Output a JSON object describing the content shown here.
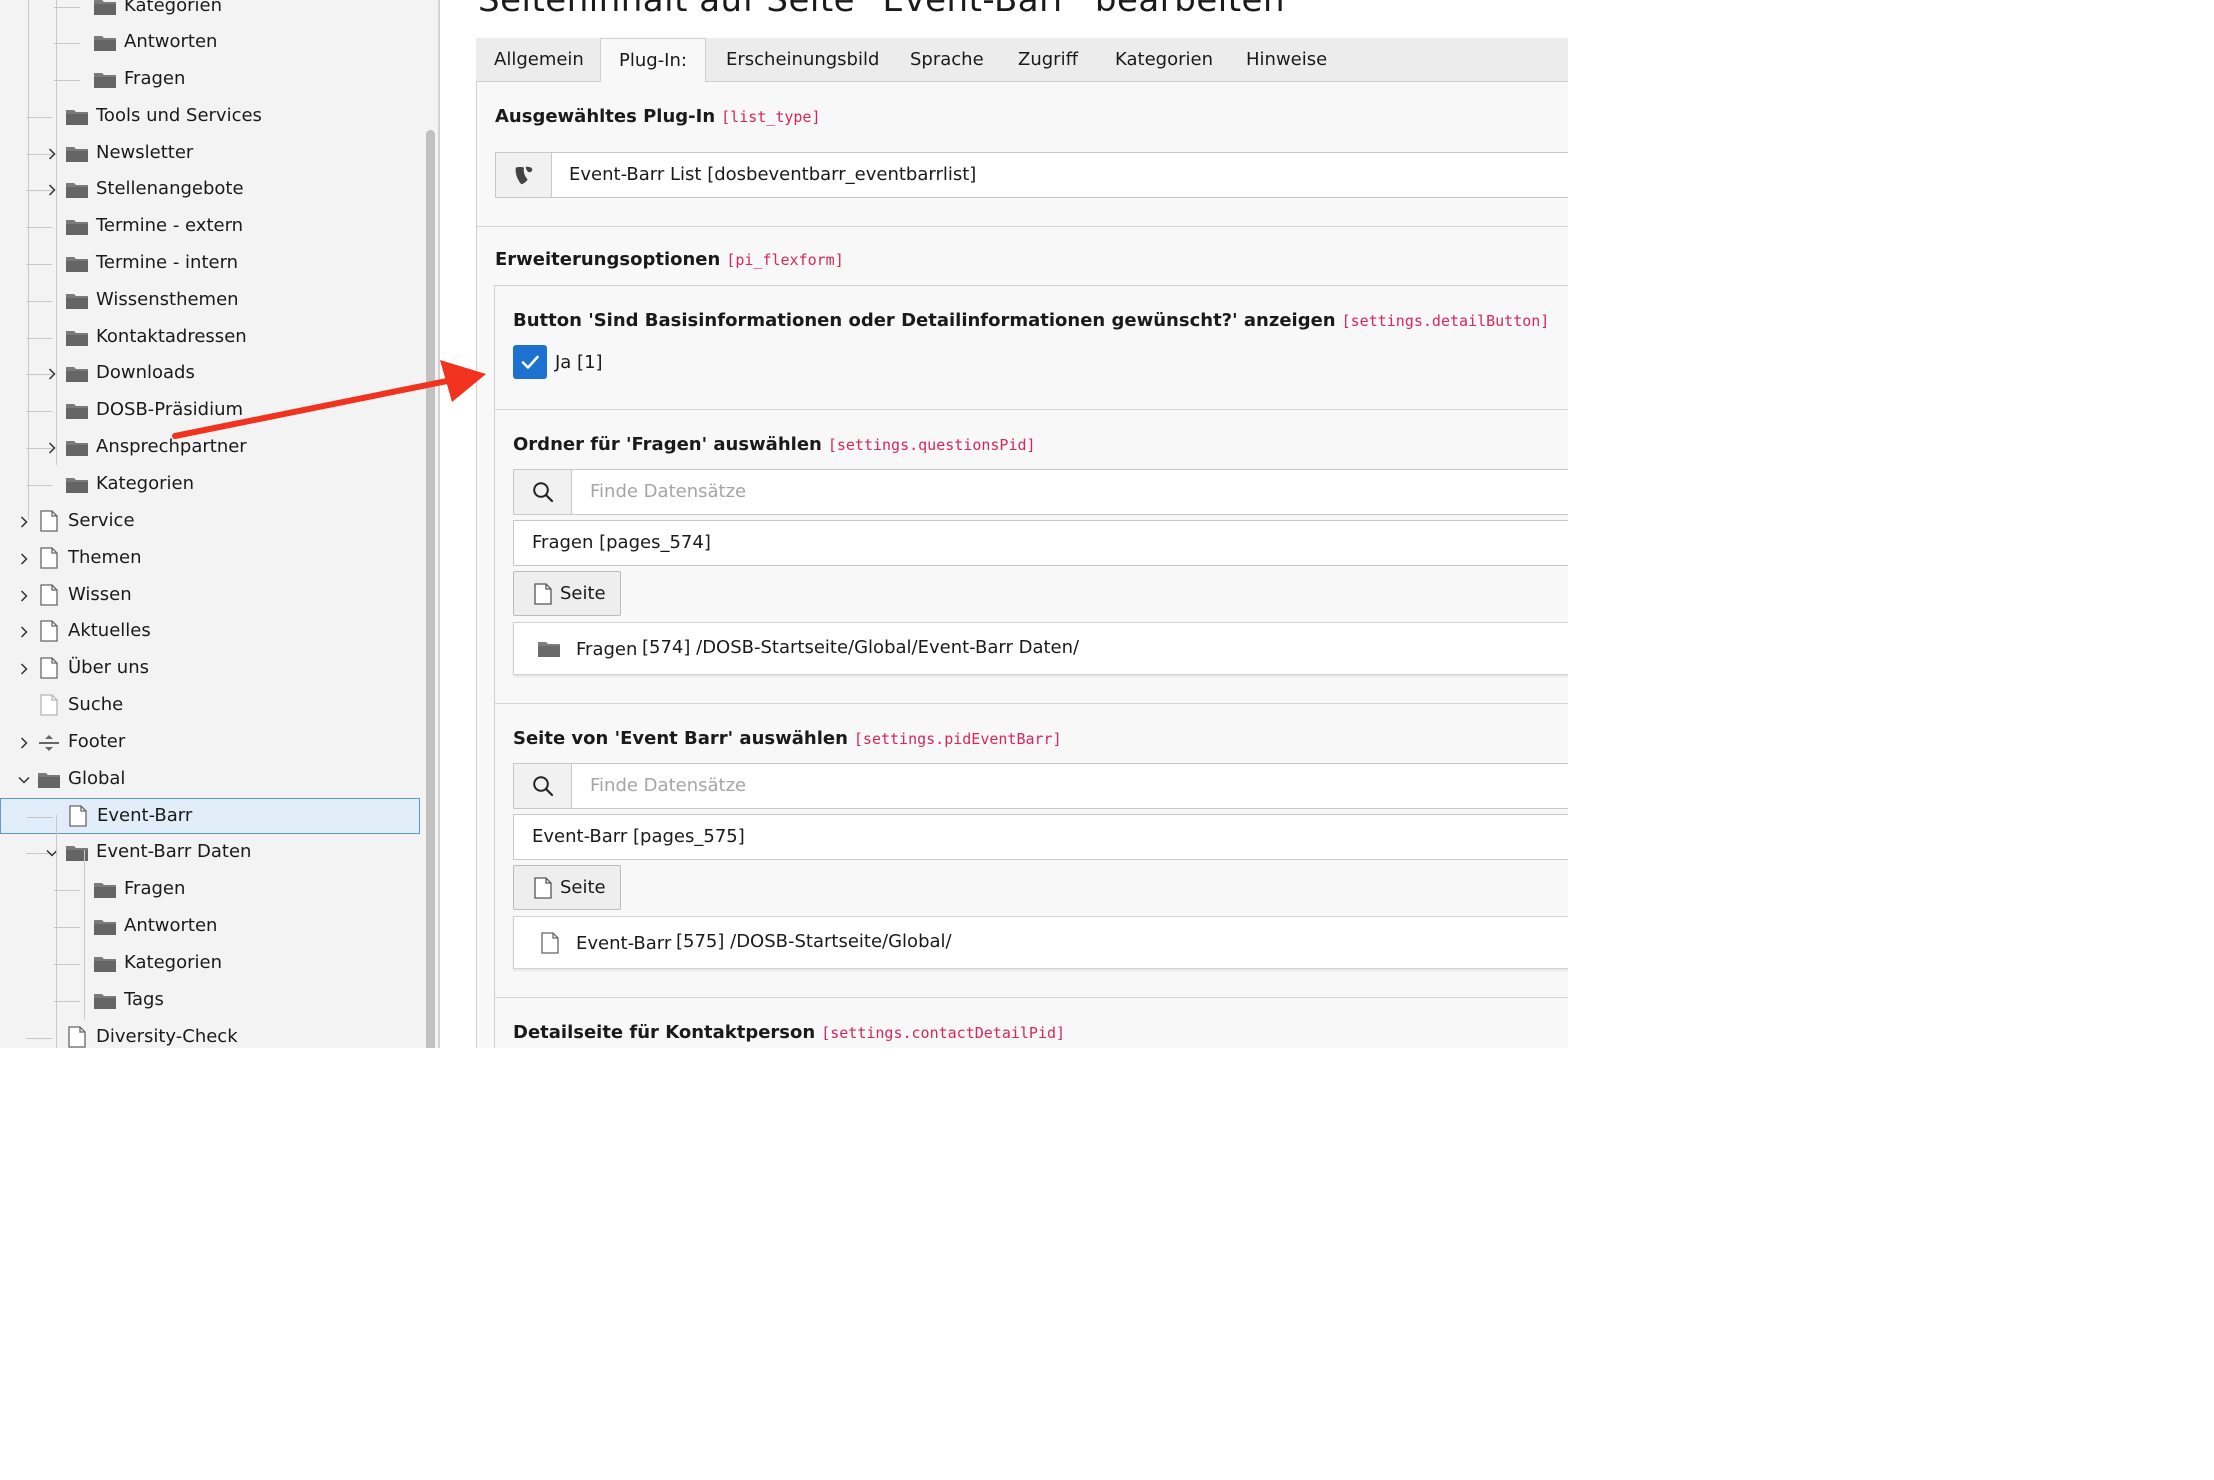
{
  "tree": {
    "rows": [
      {
        "label": "Kategorien",
        "icon": "folder"
      },
      {
        "label": "Antworten",
        "icon": "folder"
      },
      {
        "label": "Fragen",
        "icon": "folder"
      },
      {
        "label": "Tools und Services",
        "icon": "folder"
      },
      {
        "label": "Newsletter",
        "icon": "folder"
      },
      {
        "label": "Stellenangebote",
        "icon": "folder"
      },
      {
        "label": "Termine - extern",
        "icon": "folder"
      },
      {
        "label": "Termine - intern",
        "icon": "folder"
      },
      {
        "label": "Wissensthemen",
        "icon": "folder"
      },
      {
        "label": "Kontaktadressen",
        "icon": "folder"
      },
      {
        "label": "Downloads",
        "icon": "folder"
      },
      {
        "label": "DOSB-Präsidium",
        "icon": "folder"
      },
      {
        "label": "Ansprechpartner",
        "icon": "folder"
      },
      {
        "label": "Kategorien",
        "icon": "folder"
      },
      {
        "label": "Service",
        "icon": "page"
      },
      {
        "label": "Themen",
        "icon": "page"
      },
      {
        "label": "Wissen",
        "icon": "page"
      },
      {
        "label": "Aktuelles",
        "icon": "page"
      },
      {
        "label": "Über uns",
        "icon": "page"
      },
      {
        "label": "Suche",
        "icon": "page-light"
      },
      {
        "label": "Footer",
        "icon": "divider"
      },
      {
        "label": "Global",
        "icon": "folder"
      },
      {
        "label": "Event-Barr",
        "icon": "page"
      },
      {
        "label": "Event-Barr Daten",
        "icon": "folder"
      },
      {
        "label": "Fragen",
        "icon": "folder"
      },
      {
        "label": "Antworten",
        "icon": "folder"
      },
      {
        "label": "Kategorien",
        "icon": "folder"
      },
      {
        "label": "Tags",
        "icon": "folder"
      },
      {
        "label": "Diversity-Check",
        "icon": "page"
      }
    ]
  },
  "main": {
    "title": "Seiteninhalt auf Seite \"Event-Barr\" bearbeiten",
    "tabs": [
      "Allgemein",
      "Plug-In:",
      "Erscheinungsbild",
      "Sprache",
      "Zugriff",
      "Kategorien",
      "Hinweise"
    ],
    "active_tab": "Plug-In:",
    "plugin": {
      "label": "Ausgewähltes Plug-In",
      "key": "[list_type]",
      "value": "Event-Barr List [dosbeventbarr_eventbarrlist]"
    },
    "flexform": {
      "label": "Erweiterungsoptionen",
      "key": "[pi_flexform]"
    },
    "detail_button": {
      "label": "Button 'Sind Basisinformationen oder Detailinformationen gewünscht?' anzeigen",
      "key": "[settings.detailButton]",
      "checkbox_label": "Ja [1]",
      "checked": true
    },
    "questions": {
      "label": "Ordner für 'Fragen' auswählen",
      "key": "[settings.questionsPid]",
      "search_placeholder": "Finde Datensätze",
      "selected": "Fragen [pages_574]",
      "button": "Seite",
      "record_title": "Fragen",
      "record_path": "[574] /DOSB-Startseite/Global/Event-Barr Daten/"
    },
    "eventbarr": {
      "label": "Seite von 'Event Barr' auswählen",
      "key": "[settings.pidEventBarr]",
      "search_placeholder": "Finde Datensätze",
      "selected": "Event-Barr [pages_575]",
      "button": "Seite",
      "record_title": "Event-Barr",
      "record_path": "[575] /DOSB-Startseite/Global/"
    },
    "contact": {
      "label": "Detailseite für Kontaktperson",
      "key": "[settings.contactDetailPid]"
    }
  },
  "colors": {
    "accent": "#1d72d1",
    "field_key": "#d7265b",
    "annotation_arrow": "#f0321e"
  }
}
